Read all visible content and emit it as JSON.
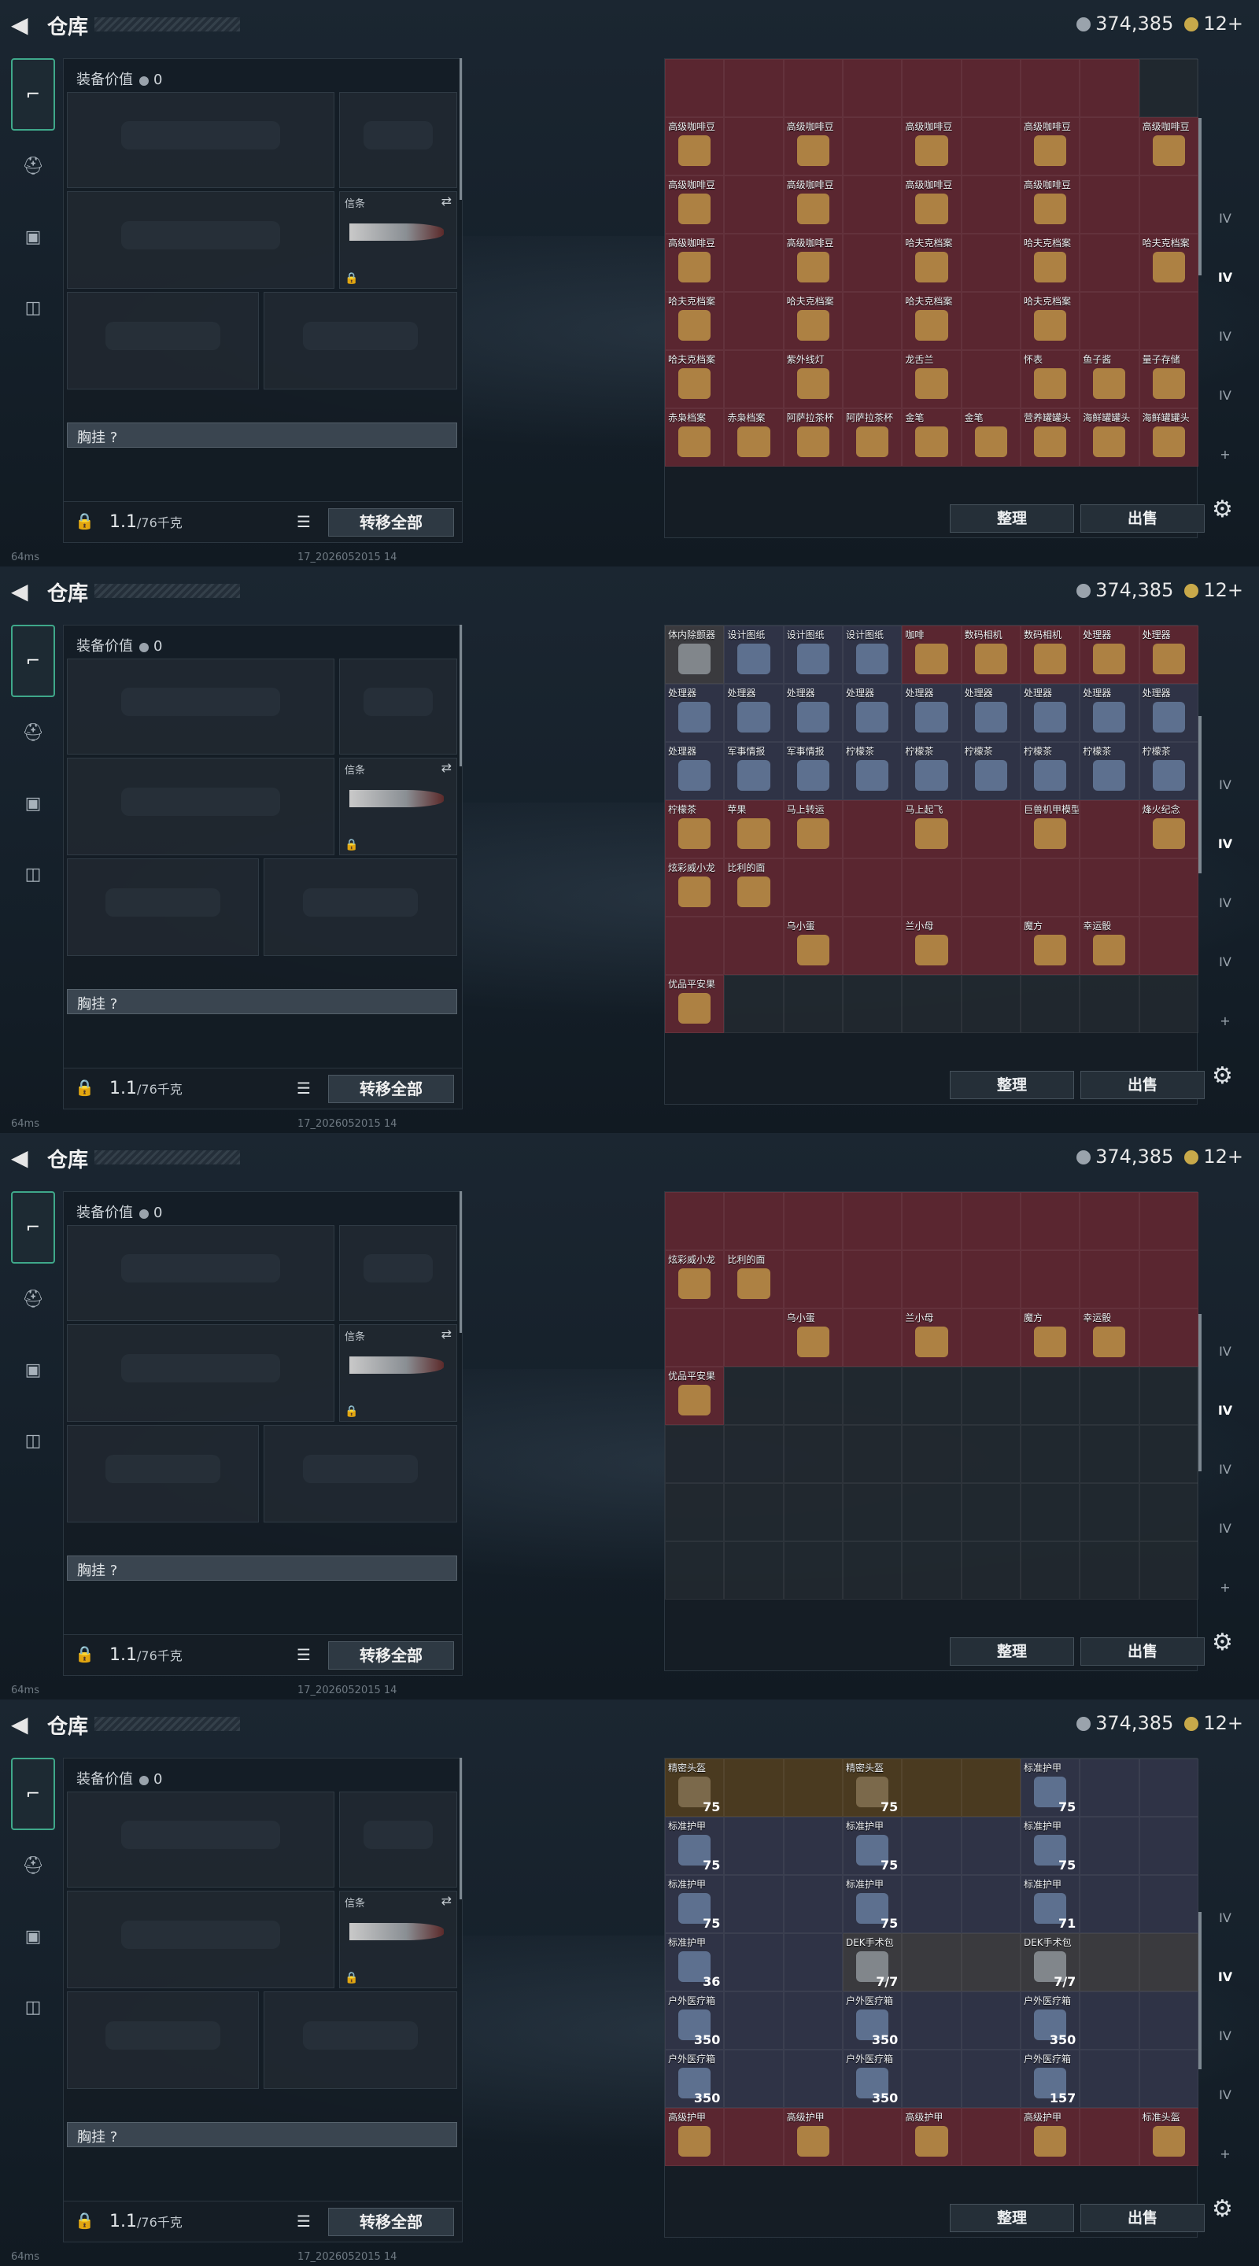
{
  "header": {
    "title": "仓库",
    "currency_main": "374,385",
    "currency_gold": "12+"
  },
  "equip": {
    "value_label": "装备价值",
    "value": "0",
    "slot_knife": "信条",
    "chest": "胸挂 ?",
    "weight": "1.1",
    "weight_unit": "/76千克",
    "transfer": "转移全部"
  },
  "status": {
    "ping": "64ms",
    "build": "17_2026052015 14"
  },
  "buttons": {
    "sort": "整理",
    "sell": "出售"
  },
  "righttabs": [
    "",
    "",
    "IV",
    "IV",
    "IV",
    "IV",
    "+"
  ],
  "panels": [
    {
      "cells": [
        [
          "r",
          "",
          ""
        ],
        [
          "r",
          "",
          ""
        ],
        [
          "r",
          "",
          ""
        ],
        [
          "r",
          "",
          ""
        ],
        [
          "r",
          "",
          ""
        ],
        [
          "r",
          "",
          ""
        ],
        [
          "r",
          "",
          ""
        ],
        [
          "r",
          "",
          ""
        ],
        [
          "e",
          "",
          ""
        ],
        [
          "r",
          "高级咖啡豆",
          ""
        ],
        [
          "r",
          "",
          ""
        ],
        [
          "r",
          "高级咖啡豆",
          ""
        ],
        [
          "r",
          "",
          ""
        ],
        [
          "r",
          "高级咖啡豆",
          ""
        ],
        [
          "r",
          "",
          ""
        ],
        [
          "r",
          "高级咖啡豆",
          ""
        ],
        [
          "r",
          "",
          ""
        ],
        [
          "r",
          "高级咖啡豆",
          ""
        ],
        [
          "r",
          "高级咖啡豆",
          ""
        ],
        [
          "r",
          "",
          ""
        ],
        [
          "r",
          "高级咖啡豆",
          ""
        ],
        [
          "r",
          "",
          ""
        ],
        [
          "r",
          "高级咖啡豆",
          ""
        ],
        [
          "r",
          "",
          ""
        ],
        [
          "r",
          "高级咖啡豆",
          ""
        ],
        [
          "r",
          "",
          ""
        ],
        [
          "r",
          "",
          ""
        ],
        [
          "r",
          "高级咖啡豆",
          ""
        ],
        [
          "r",
          "",
          ""
        ],
        [
          "r",
          "高级咖啡豆",
          ""
        ],
        [
          "r",
          "",
          ""
        ],
        [
          "r",
          "哈夫克档案",
          ""
        ],
        [
          "r",
          "",
          ""
        ],
        [
          "r",
          "哈夫克档案",
          ""
        ],
        [
          "r",
          "",
          ""
        ],
        [
          "r",
          "哈夫克档案",
          ""
        ],
        [
          "r",
          "哈夫克档案",
          ""
        ],
        [
          "r",
          "",
          ""
        ],
        [
          "r",
          "哈夫克档案",
          ""
        ],
        [
          "r",
          "",
          ""
        ],
        [
          "r",
          "哈夫克档案",
          ""
        ],
        [
          "r",
          "",
          ""
        ],
        [
          "r",
          "哈夫克档案",
          ""
        ],
        [
          "r",
          "",
          ""
        ],
        [
          "r",
          "",
          ""
        ],
        [
          "r",
          "哈夫克档案",
          ""
        ],
        [
          "r",
          "",
          ""
        ],
        [
          "r",
          "紫外线灯",
          ""
        ],
        [
          "r",
          "",
          ""
        ],
        [
          "r",
          "龙舌兰",
          ""
        ],
        [
          "r",
          "",
          ""
        ],
        [
          "r",
          "怀表",
          ""
        ],
        [
          "r",
          "鱼子酱",
          ""
        ],
        [
          "r",
          "量子存储",
          ""
        ],
        [
          "r",
          "赤枭档案",
          ""
        ],
        [
          "r",
          "赤枭档案",
          ""
        ],
        [
          "r",
          "阿萨拉茶杯",
          ""
        ],
        [
          "r",
          "阿萨拉茶杯",
          ""
        ],
        [
          "r",
          "金笔",
          ""
        ],
        [
          "r",
          "金笔",
          ""
        ],
        [
          "r",
          "营养罐罐头",
          ""
        ],
        [
          "r",
          "海鲜罐罐头",
          ""
        ],
        [
          "r",
          "海鲜罐罐头",
          ""
        ]
      ]
    },
    {
      "cells": [
        [
          "g",
          "体内除颤器",
          ""
        ],
        [
          "p",
          "设计图纸",
          ""
        ],
        [
          "p",
          "设计图纸",
          ""
        ],
        [
          "p",
          "设计图纸",
          ""
        ],
        [
          "r",
          "咖啡",
          ""
        ],
        [
          "r",
          "数码相机",
          ""
        ],
        [
          "r",
          "数码相机",
          ""
        ],
        [
          "r",
          "处理器",
          ""
        ],
        [
          "r",
          "处理器",
          ""
        ],
        [
          "p",
          "处理器",
          ""
        ],
        [
          "p",
          "处理器",
          ""
        ],
        [
          "p",
          "处理器",
          ""
        ],
        [
          "p",
          "处理器",
          ""
        ],
        [
          "p",
          "处理器",
          ""
        ],
        [
          "p",
          "处理器",
          ""
        ],
        [
          "p",
          "处理器",
          ""
        ],
        [
          "p",
          "处理器",
          ""
        ],
        [
          "p",
          "处理器",
          ""
        ],
        [
          "p",
          "处理器",
          ""
        ],
        [
          "p",
          "军事情报",
          ""
        ],
        [
          "p",
          "军事情报",
          ""
        ],
        [
          "p",
          "柠檬茶",
          ""
        ],
        [
          "p",
          "柠檬茶",
          ""
        ],
        [
          "p",
          "柠檬茶",
          ""
        ],
        [
          "p",
          "柠檬茶",
          ""
        ],
        [
          "p",
          "柠檬茶",
          ""
        ],
        [
          "p",
          "柠檬茶",
          ""
        ],
        [
          "r",
          "柠檬茶",
          ""
        ],
        [
          "r",
          "苹果",
          ""
        ],
        [
          "r",
          "马上转运",
          ""
        ],
        [
          "r",
          "",
          ""
        ],
        [
          "r",
          "马上起飞",
          ""
        ],
        [
          "r",
          "",
          ""
        ],
        [
          "r",
          "巨兽机甲模型",
          ""
        ],
        [
          "r",
          "",
          ""
        ],
        [
          "r",
          "烽火纪念",
          ""
        ],
        [
          "r",
          "炫彩威小龙",
          ""
        ],
        [
          "r",
          "比利的面",
          ""
        ],
        [
          "r",
          "",
          ""
        ],
        [
          "r",
          "",
          ""
        ],
        [
          "r",
          "",
          ""
        ],
        [
          "r",
          "",
          ""
        ],
        [
          "r",
          "",
          ""
        ],
        [
          "r",
          "",
          ""
        ],
        [
          "r",
          "",
          ""
        ],
        [
          "r",
          "",
          ""
        ],
        [
          "r",
          "",
          ""
        ],
        [
          "r",
          "乌小蛋",
          ""
        ],
        [
          "r",
          "",
          ""
        ],
        [
          "r",
          "兰小母",
          ""
        ],
        [
          "r",
          "",
          ""
        ],
        [
          "r",
          "魔方",
          ""
        ],
        [
          "r",
          "幸运骰",
          ""
        ],
        [
          "r",
          "",
          ""
        ],
        [
          "r",
          "优品平安果",
          ""
        ],
        [
          "e",
          "",
          ""
        ],
        [
          "e",
          "",
          ""
        ],
        [
          "e",
          "",
          ""
        ],
        [
          "e",
          "",
          ""
        ],
        [
          "e",
          "",
          ""
        ],
        [
          "e",
          "",
          ""
        ],
        [
          "e",
          "",
          ""
        ],
        [
          "e",
          "",
          ""
        ]
      ]
    },
    {
      "cells": [
        [
          "r",
          "",
          ""
        ],
        [
          "r",
          "",
          ""
        ],
        [
          "r",
          "",
          ""
        ],
        [
          "r",
          "",
          ""
        ],
        [
          "r",
          "",
          ""
        ],
        [
          "r",
          "",
          ""
        ],
        [
          "r",
          "",
          ""
        ],
        [
          "r",
          "",
          ""
        ],
        [
          "r",
          "",
          ""
        ],
        [
          "r",
          "炫彩威小龙",
          ""
        ],
        [
          "r",
          "比利的面",
          ""
        ],
        [
          "r",
          "",
          ""
        ],
        [
          "r",
          "",
          ""
        ],
        [
          "r",
          "",
          ""
        ],
        [
          "r",
          "",
          ""
        ],
        [
          "r",
          "",
          ""
        ],
        [
          "r",
          "",
          ""
        ],
        [
          "r",
          "",
          ""
        ],
        [
          "r",
          "",
          ""
        ],
        [
          "r",
          "",
          ""
        ],
        [
          "r",
          "乌小蛋",
          ""
        ],
        [
          "r",
          "",
          ""
        ],
        [
          "r",
          "兰小母",
          ""
        ],
        [
          "r",
          "",
          ""
        ],
        [
          "r",
          "魔方",
          ""
        ],
        [
          "r",
          "幸运骰",
          ""
        ],
        [
          "r",
          "",
          ""
        ],
        [
          "r",
          "优品平安果",
          ""
        ],
        [
          "e",
          "",
          ""
        ],
        [
          "e",
          "",
          ""
        ],
        [
          "e",
          "",
          ""
        ],
        [
          "e",
          "",
          ""
        ],
        [
          "e",
          "",
          ""
        ],
        [
          "e",
          "",
          ""
        ],
        [
          "e",
          "",
          ""
        ],
        [
          "e",
          "",
          ""
        ],
        [
          "e",
          "",
          ""
        ],
        [
          "e",
          "",
          ""
        ],
        [
          "e",
          "",
          ""
        ],
        [
          "e",
          "",
          ""
        ],
        [
          "e",
          "",
          ""
        ],
        [
          "e",
          "",
          ""
        ],
        [
          "e",
          "",
          ""
        ],
        [
          "e",
          "",
          ""
        ],
        [
          "e",
          "",
          ""
        ],
        [
          "e",
          "",
          ""
        ],
        [
          "e",
          "",
          ""
        ],
        [
          "e",
          "",
          ""
        ],
        [
          "e",
          "",
          ""
        ],
        [
          "e",
          "",
          ""
        ],
        [
          "e",
          "",
          ""
        ],
        [
          "e",
          "",
          ""
        ],
        [
          "e",
          "",
          ""
        ],
        [
          "e",
          "",
          ""
        ],
        [
          "e",
          "",
          ""
        ],
        [
          "e",
          "",
          ""
        ],
        [
          "e",
          "",
          ""
        ],
        [
          "e",
          "",
          ""
        ],
        [
          "e",
          "",
          ""
        ],
        [
          "e",
          "",
          ""
        ],
        [
          "e",
          "",
          ""
        ],
        [
          "e",
          "",
          ""
        ],
        [
          "e",
          "",
          ""
        ]
      ]
    },
    {
      "cells": [
        [
          "y",
          "精密头盔",
          "75"
        ],
        [
          "y",
          "",
          ""
        ],
        [
          "y",
          "",
          ""
        ],
        [
          "y",
          "精密头盔",
          "75"
        ],
        [
          "y",
          "",
          ""
        ],
        [
          "y",
          "",
          ""
        ],
        [
          "p",
          "标准护甲",
          "75"
        ],
        [
          "p",
          "",
          ""
        ],
        [
          "p",
          "",
          ""
        ],
        [
          "p",
          "标准护甲",
          "75"
        ],
        [
          "p",
          "",
          ""
        ],
        [
          "p",
          "",
          ""
        ],
        [
          "p",
          "标准护甲",
          "75"
        ],
        [
          "p",
          "",
          ""
        ],
        [
          "p",
          "",
          ""
        ],
        [
          "p",
          "标准护甲",
          "75"
        ],
        [
          "p",
          "",
          ""
        ],
        [
          "p",
          "",
          ""
        ],
        [
          "p",
          "标准护甲",
          "75"
        ],
        [
          "p",
          "",
          ""
        ],
        [
          "p",
          "",
          ""
        ],
        [
          "p",
          "标准护甲",
          "75"
        ],
        [
          "p",
          "",
          ""
        ],
        [
          "p",
          "",
          ""
        ],
        [
          "p",
          "标准护甲",
          "71"
        ],
        [
          "p",
          "",
          ""
        ],
        [
          "p",
          "",
          ""
        ],
        [
          "p",
          "标准护甲",
          "36"
        ],
        [
          "p",
          "",
          ""
        ],
        [
          "p",
          "",
          ""
        ],
        [
          "g",
          "DEK手术包",
          "7/7"
        ],
        [
          "g",
          "",
          ""
        ],
        [
          "g",
          "",
          ""
        ],
        [
          "g",
          "DEK手术包",
          "7/7"
        ],
        [
          "g",
          "",
          ""
        ],
        [
          "g",
          "",
          ""
        ],
        [
          "p",
          "户外医疗箱",
          "350"
        ],
        [
          "p",
          "",
          ""
        ],
        [
          "p",
          "",
          ""
        ],
        [
          "p",
          "户外医疗箱",
          "350"
        ],
        [
          "p",
          "",
          ""
        ],
        [
          "p",
          "",
          ""
        ],
        [
          "p",
          "户外医疗箱",
          "350"
        ],
        [
          "p",
          "",
          ""
        ],
        [
          "p",
          "",
          ""
        ],
        [
          "p",
          "户外医疗箱",
          "350"
        ],
        [
          "p",
          "",
          ""
        ],
        [
          "p",
          "",
          ""
        ],
        [
          "p",
          "户外医疗箱",
          "350"
        ],
        [
          "p",
          "",
          ""
        ],
        [
          "p",
          "",
          ""
        ],
        [
          "p",
          "户外医疗箱",
          "157"
        ],
        [
          "p",
          "",
          ""
        ],
        [
          "p",
          "",
          ""
        ],
        [
          "r",
          "高级护甲",
          ""
        ],
        [
          "r",
          "",
          ""
        ],
        [
          "r",
          "高级护甲",
          ""
        ],
        [
          "r",
          "",
          ""
        ],
        [
          "r",
          "高级护甲",
          ""
        ],
        [
          "r",
          "",
          ""
        ],
        [
          "r",
          "高级护甲",
          ""
        ],
        [
          "r",
          "",
          ""
        ],
        [
          "r",
          "标准头盔",
          ""
        ]
      ]
    }
  ]
}
